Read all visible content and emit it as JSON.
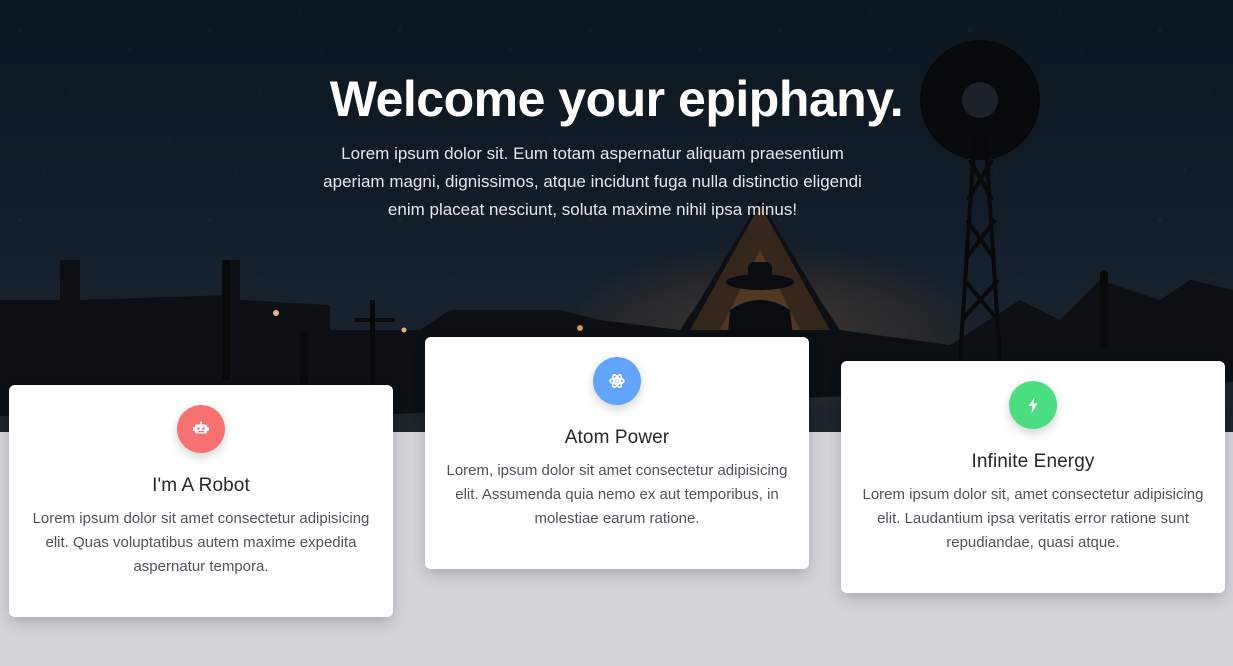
{
  "hero": {
    "title": "Welcome your epiphany.",
    "subtitle": "Lorem ipsum dolor sit. Eum totam aspernatur aliquam praesentium aperiam magni, dignissimos, atque incidunt fuga nulla distinctio eligendi enim placeat nesciunt, soluta maxime nihil ipsa minus!"
  },
  "features": [
    {
      "icon": "robot-icon",
      "color": "#f87171",
      "title": "I'm A Robot",
      "text": "Lorem ipsum dolor sit amet consectetur adipisicing elit. Quas voluptatibus autem maxime expedita aspernatur tempora."
    },
    {
      "icon": "atom-icon",
      "color": "#60a5fa",
      "title": "Atom Power",
      "text": "Lorem, ipsum dolor sit amet consectetur adipisicing elit. Assumenda quia nemo ex aut temporibus, in molestiae earum ratione."
    },
    {
      "icon": "bolt-icon",
      "color": "#4ade80",
      "title": "Infinite Energy",
      "text": "Lorem ipsum dolor sit, amet consectetur adipisicing elit. Laudantium ipsa veritatis error ratione sunt repudiandae, quasi atque."
    }
  ]
}
